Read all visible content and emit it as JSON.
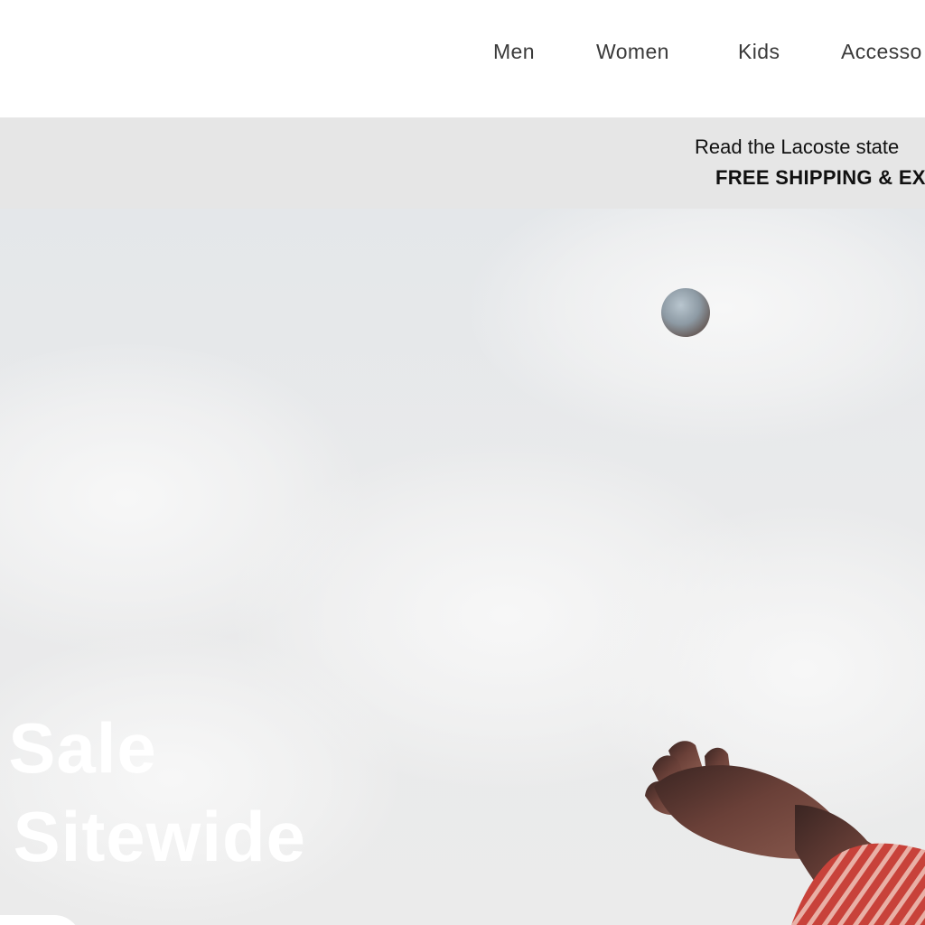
{
  "nav": {
    "items": [
      {
        "label": "Men"
      },
      {
        "label": "Women"
      },
      {
        "label": "Kids"
      },
      {
        "label": "Accesso"
      }
    ]
  },
  "announcement": {
    "line1": "Read the Lacoste state",
    "line2": "FREE SHIPPING & EX"
  },
  "hero": {
    "title_line1": "g Sale",
    "title_line2": "ff Sitewide",
    "ball_icon": "tennis-ball",
    "hand_image": "hand-reaching"
  },
  "colors": {
    "header_bg": "#ffffff",
    "announce_bg": "#e6e6e6",
    "nav_text": "#3a3a3a",
    "hero_text": "#ffffff",
    "sleeve": "#c8423a"
  }
}
